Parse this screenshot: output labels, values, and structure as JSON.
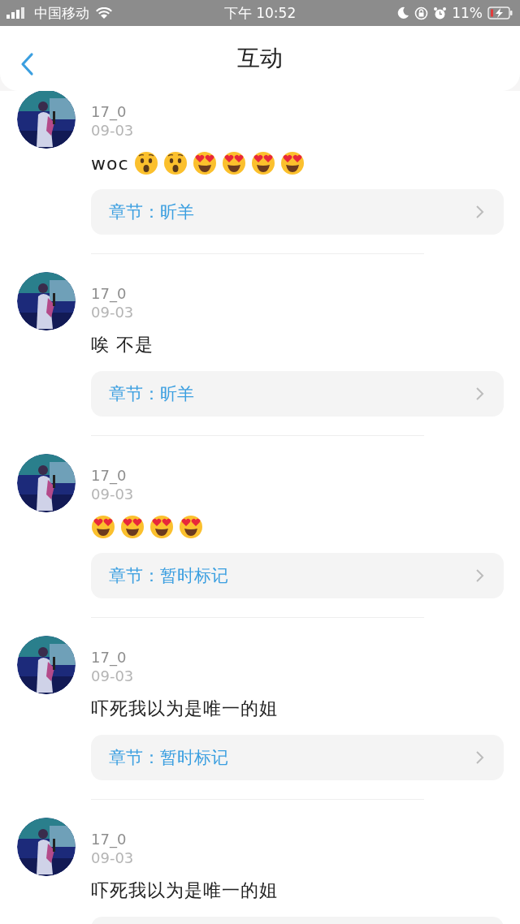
{
  "status_bar": {
    "carrier": "中国移动",
    "time": "下午 10:52",
    "battery": "11%"
  },
  "header": {
    "title": "互动"
  },
  "comments": [
    {
      "user": "17_0",
      "date": "09-03",
      "text": "woc",
      "emojis": [
        {
          "kind": "astonished"
        },
        {
          "kind": "astonished"
        },
        {
          "kind": "heart_eyes"
        },
        {
          "kind": "heart_eyes"
        },
        {
          "kind": "heart_eyes"
        },
        {
          "kind": "heart_eyes"
        }
      ],
      "chapter": "章节：昕羊"
    },
    {
      "user": "17_0",
      "date": "09-03",
      "text": "唉 不是",
      "chapter": "章节：昕羊"
    },
    {
      "user": "17_0",
      "date": "09-03",
      "emojis": [
        {
          "kind": "heart_eyes"
        },
        {
          "kind": "heart_eyes"
        },
        {
          "kind": "heart_eyes"
        },
        {
          "kind": "heart_eyes"
        }
      ],
      "chapter": "章节：暂时标记"
    },
    {
      "user": "17_0",
      "date": "09-03",
      "text": "吓死我以为是唯一的姐",
      "chapter": "章节：暂时标记"
    },
    {
      "user": "17_0",
      "date": "09-03",
      "text": "吓死我以为是唯一的姐"
    }
  ]
}
